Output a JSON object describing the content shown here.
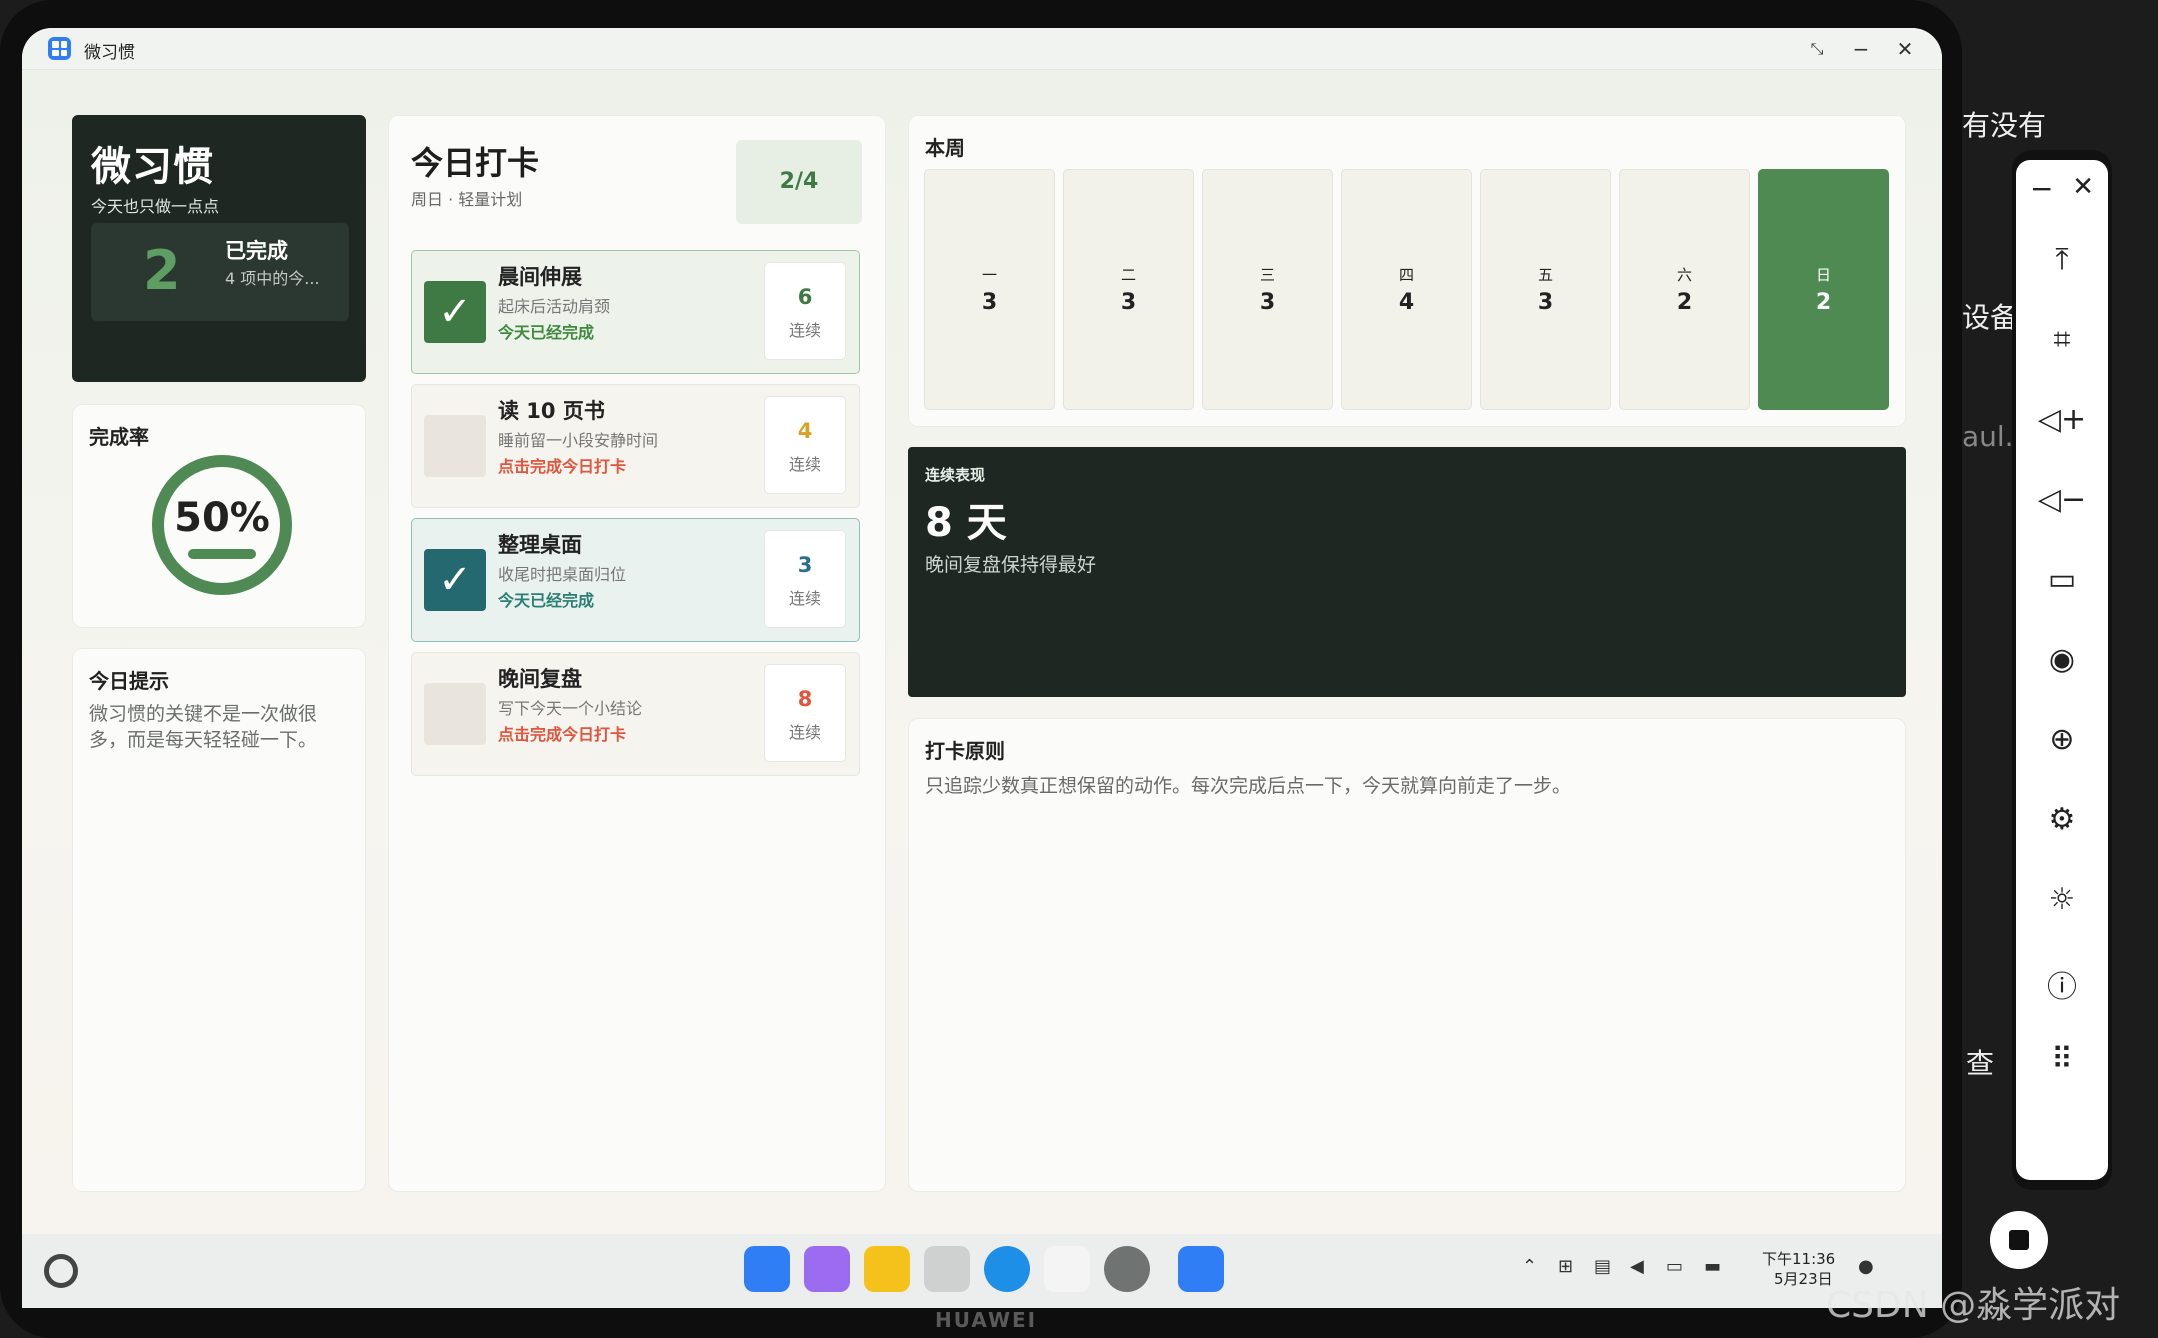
{
  "window": {
    "title": "微习惯"
  },
  "hero": {
    "title": "微习惯",
    "subtitle": "今天也只做一点点",
    "count": "2",
    "done_label": "已完成",
    "summary": "4 项中的今..."
  },
  "rate": {
    "label": "完成率",
    "percent": "50%",
    "value": 0.5
  },
  "tip": {
    "label": "今日提示",
    "text": "微习惯的关键不是一次做很多，而是每天轻轻碰一下。"
  },
  "checkin": {
    "title": "今日打卡",
    "subtitle": "周日 · 轻量计划",
    "progress": "2/4",
    "habits": [
      {
        "name": "晨间伸展",
        "desc": "起床后活动肩颈",
        "status": "今天已经完成",
        "streak": "6",
        "unit": "连续",
        "done": true,
        "status_color": "#3f8a3f",
        "streak_color": "#3f7a45",
        "check": "✓"
      },
      {
        "name": "读 10 页书",
        "desc": "睡前留一小段安静时间",
        "status": "点击完成今日打卡",
        "streak": "4",
        "unit": "连续",
        "done": false,
        "status_color": "#e0553c",
        "streak_color": "#d9a227",
        "check": ""
      },
      {
        "name": "整理桌面",
        "desc": "收尾时把桌面归位",
        "status": "今天已经完成",
        "streak": "3",
        "unit": "连续",
        "done": true,
        "status_color": "#2a7f72",
        "streak_color": "#2a6f8a",
        "check": "✓"
      },
      {
        "name": "晚间复盘",
        "desc": "写下今天一个小结论",
        "status": "点击完成今日打卡",
        "streak": "8",
        "unit": "连续",
        "done": false,
        "status_color": "#e0553c",
        "streak_color": "#e0553c",
        "check": ""
      }
    ]
  },
  "week": {
    "label": "本周",
    "days": [
      {
        "d": "一",
        "v": "3"
      },
      {
        "d": "二",
        "v": "3"
      },
      {
        "d": "三",
        "v": "3"
      },
      {
        "d": "四",
        "v": "4"
      },
      {
        "d": "五",
        "v": "3"
      },
      {
        "d": "六",
        "v": "2"
      },
      {
        "d": "日",
        "v": "2"
      }
    ]
  },
  "streak": {
    "label": "连续表现",
    "value": "8 天",
    "text": "晚间复盘保持得最好"
  },
  "rule": {
    "label": "打卡原则",
    "text": "只追踪少数真正想保留的动作。每次完成后点一下，今天就算向前走了一步。"
  },
  "taskbar": {
    "time": "下午11:36",
    "date": "5月23日"
  },
  "device": {
    "brand": "HUAWEI"
  },
  "background": {
    "t1": "有没有",
    "t2": "设备",
    "t3": "aul...",
    "t4": "查"
  },
  "watermark": "CSDN @淼学派对",
  "colors": {
    "accent": "#4e8a52",
    "dark": "#1f2722"
  }
}
